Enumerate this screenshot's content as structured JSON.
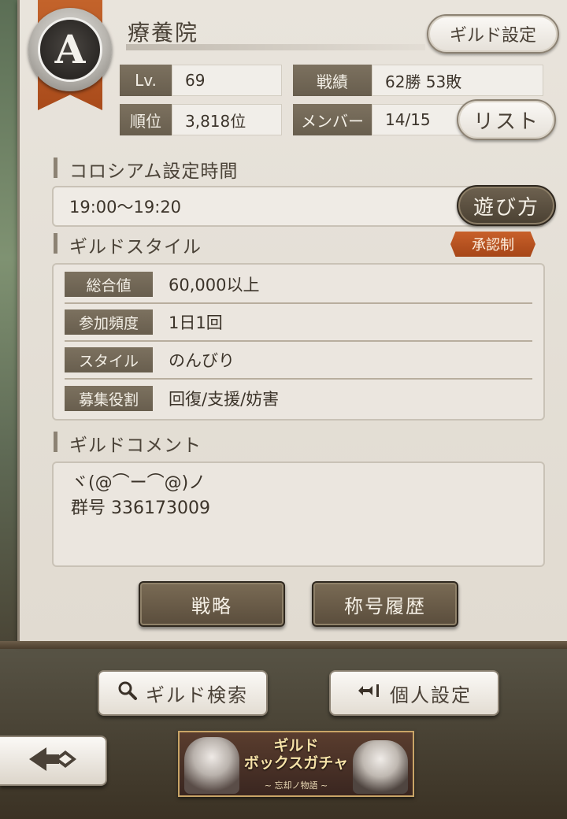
{
  "guild": {
    "rank_letter": "A",
    "name": "療養院",
    "settings_button": "ギルド設定",
    "list_button": "リスト"
  },
  "stats": {
    "level_label": "Lv.",
    "level_value": "69",
    "record_label": "戦績",
    "record_value": "62勝  53敗",
    "rank_label": "順位",
    "rank_value": "3,818位",
    "members_label": "メンバー",
    "members_value": "14/15"
  },
  "colosseum": {
    "heading": "コロシアム設定時間",
    "time": "19:00〜19:20",
    "howto_button": "遊び方"
  },
  "style": {
    "heading": "ギルドスタイル",
    "approval_badge": "承認制",
    "rows": [
      {
        "key": "総合値",
        "value": "60,000以上"
      },
      {
        "key": "参加頻度",
        "value": "1日1回"
      },
      {
        "key": "スタイル",
        "value": "のんびり"
      },
      {
        "key": "募集役割",
        "value": "回復/支援/妨害"
      }
    ]
  },
  "comment": {
    "heading": "ギルドコメント",
    "line1": "ヾ(@⌒ー⌒@)ノ",
    "line2": "群号 336173009"
  },
  "actions": {
    "strategy": "戦略",
    "title_history": "称号履歴",
    "guild_search": "ギルド検索",
    "personal_settings": "個人設定"
  },
  "banner": {
    "title_line1": "ギルド",
    "title_line2": "ボックスガチャ",
    "subtitle": "~ 忘却ノ物語 ~"
  },
  "colors": {
    "accent_orange": "#c3632b",
    "panel_bg": "#e6e1d9",
    "label_brown": "#746a58",
    "dark_button": "#5a4d3c"
  },
  "icons": {
    "search": "magnifier-icon",
    "personal": "enter-arrow-icon",
    "back": "back-arrow-icon"
  }
}
